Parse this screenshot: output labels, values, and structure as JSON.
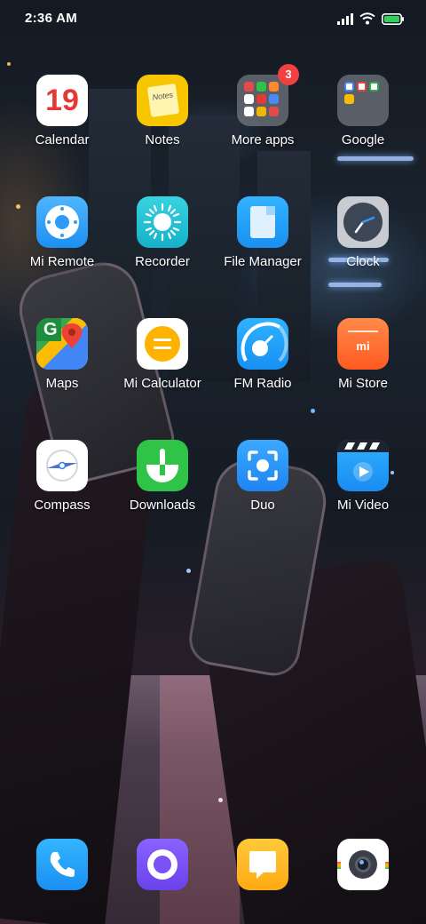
{
  "status_bar": {
    "time": "2:36 AM"
  },
  "apps": [
    {
      "label": "Calendar",
      "icon": "calendar-icon",
      "day": "19"
    },
    {
      "label": "Notes",
      "icon": "notes-icon",
      "note_text": "Notes"
    },
    {
      "label": "More apps",
      "icon": "folder-icon",
      "badge": "3"
    },
    {
      "label": "Google",
      "icon": "folder-icon"
    },
    {
      "label": "Mi Remote",
      "icon": "remote-icon"
    },
    {
      "label": "Recorder",
      "icon": "recorder-icon"
    },
    {
      "label": "File Manager",
      "icon": "file-icon"
    },
    {
      "label": "Clock",
      "icon": "clock-icon"
    },
    {
      "label": "Maps",
      "icon": "maps-icon",
      "letter": "G"
    },
    {
      "label": "Mi Calculator",
      "icon": "calculator-icon"
    },
    {
      "label": "FM Radio",
      "icon": "radio-icon"
    },
    {
      "label": "Mi Store",
      "icon": "store-icon",
      "logo": "mi"
    },
    {
      "label": "Compass",
      "icon": "compass-icon"
    },
    {
      "label": "Downloads",
      "icon": "download-icon"
    },
    {
      "label": "Duo",
      "icon": "duo-icon"
    },
    {
      "label": "Mi Video",
      "icon": "video-icon"
    }
  ],
  "dock": [
    {
      "name": "phone",
      "icon": "phone-icon"
    },
    {
      "name": "browser",
      "icon": "browser-icon"
    },
    {
      "name": "messages",
      "icon": "message-icon"
    },
    {
      "name": "camera",
      "icon": "camera-icon"
    }
  ],
  "colors": {
    "calendar_red": "#e53935",
    "notes_yellow": "#f7c600",
    "mi_orange": "#ff6a2b",
    "downloads_green": "#2fc447",
    "blue": "#1aa3f5",
    "badge_red": "#f04040"
  }
}
